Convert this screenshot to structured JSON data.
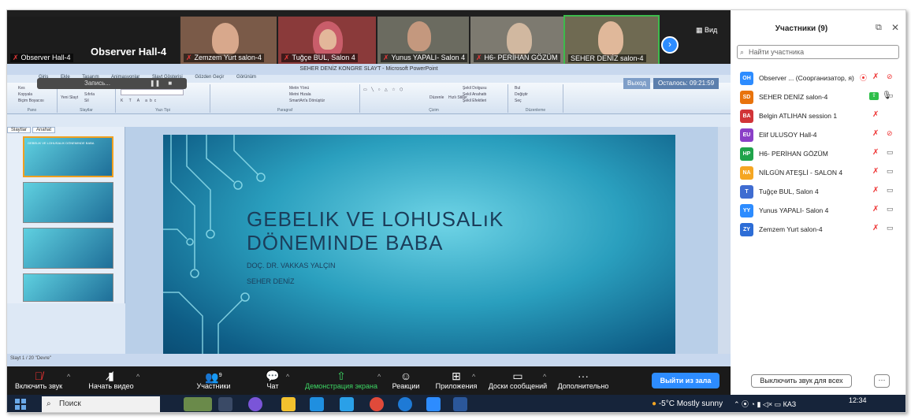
{
  "gallery": {
    "tiles": [
      {
        "name": "Observer  Hall-4",
        "title": "Observer  Hall-4"
      },
      {
        "name": "Zemzem Yurt salon-4"
      },
      {
        "name": "Tuğçe BUL, Salon 4"
      },
      {
        "name": "Yunus YAPALI- Salon 4"
      },
      {
        "name": "H6- PERİHAN GÖZÜM"
      },
      {
        "name": "SEHER DENİZ salon-4"
      }
    ],
    "view_label": "Вид"
  },
  "recording": {
    "label": "Запись..."
  },
  "timer": {
    "exit_label": "Выход",
    "remaining": "Осталось: 09:21:59"
  },
  "powerpoint": {
    "window_title": "SEHER DENİZ KONGRE SLAYT - Microsoft PowerPoint",
    "tabs": [
      "Giriş",
      "Ekle",
      "Tasarım",
      "Animasyonlar",
      "Slayt Gösterisi",
      "Gözden Geçir",
      "Görünüm"
    ],
    "groups": [
      "Pano",
      "Slaytlar",
      "Yazı Tipi",
      "Paragraf",
      "Çizim",
      "Düzenleme"
    ],
    "ribbon_texts": [
      "Kes",
      "Kopyala",
      "Biçim Boyacısı",
      "Yeni Slayt",
      "Düzen",
      "Sıfırla",
      "Sil",
      "Metin Yönü",
      "Metni Hizala",
      "SmartArt'a Dönüştür",
      "Düzenle",
      "Hızlı Stiller",
      "Şekil Dolgusu",
      "Şekil Anahattı",
      "Şekil Efektleri",
      "Bul",
      "Değiştir",
      "Seç"
    ],
    "panel_tabs": [
      "Slaytlar",
      "Anahat"
    ],
    "thumb1_text": "GEBELIK VE LOHUSALIK DÖNEMINDE BABA",
    "status": "Slayt 1 / 20   \"Devre\"",
    "slide": {
      "title_line1": "GEBELIK VE LOHUSALıK",
      "title_line2": "DÖNEMINDE BABA",
      "author": "DOÇ. DR. VAKKAS YALÇIN",
      "presenter": "SEHER DENİZ"
    }
  },
  "toolbar": {
    "mute": "Включить звук",
    "video": "Начать видео",
    "participants": "Участники",
    "participants_count": "9",
    "chat": "Чат",
    "share": "Демонстрация экрана",
    "reactions": "Реакции",
    "apps": "Приложения",
    "whiteboards": "Доски сообщений",
    "more": "Дополнительно",
    "leave": "Выйти из зала"
  },
  "participants_panel": {
    "title": "Участники (9)",
    "search_placeholder": "Найти участника",
    "mute_all": "Выключить звук для всех",
    "more": "···",
    "participants": [
      {
        "initials": "OH",
        "name": "Observer ... (Соорганизатор, я)",
        "color": "#2d8cff",
        "video": "off"
      },
      {
        "initials": "SD",
        "name": "SEHER DENİZ salon-4",
        "color": "#e8730c",
        "video": "sharing"
      },
      {
        "initials": "BA",
        "name": "Belgin ATLIHAN session 1",
        "color": "#d13438",
        "video": "none"
      },
      {
        "initials": "EU",
        "name": "Elif ULUSOY Hall-4",
        "color": "#8a3fc7",
        "video": "off"
      },
      {
        "initials": "HP",
        "name": "H6- PERİHAN GÖZÜM",
        "color": "#1fa34a",
        "video": "on"
      },
      {
        "initials": "NA",
        "name": "NİLGÜN ATEŞLİ - SALON 4",
        "color": "#f5a623",
        "video": "on"
      },
      {
        "initials": "T",
        "name": "Tuğçe BUL, Salon 4",
        "color": "#3f6cd1",
        "video": "on"
      },
      {
        "initials": "YY",
        "name": "Yunus YAPALI- Salon 4",
        "color": "#2d8cff",
        "video": "on"
      },
      {
        "initials": "ZY",
        "name": "Zemzem Yurt salon-4",
        "color": "#2d6dd6",
        "video": "on"
      }
    ]
  },
  "taskbar": {
    "search": "Поиск",
    "weather": "-5°C  Mostly sunny",
    "lang": "КАЗ",
    "time": "12:34"
  },
  "colors": {
    "zoom_blue": "#2d8cff",
    "muted_red": "#e33333",
    "zoom_dark": "#1f1f1f"
  }
}
